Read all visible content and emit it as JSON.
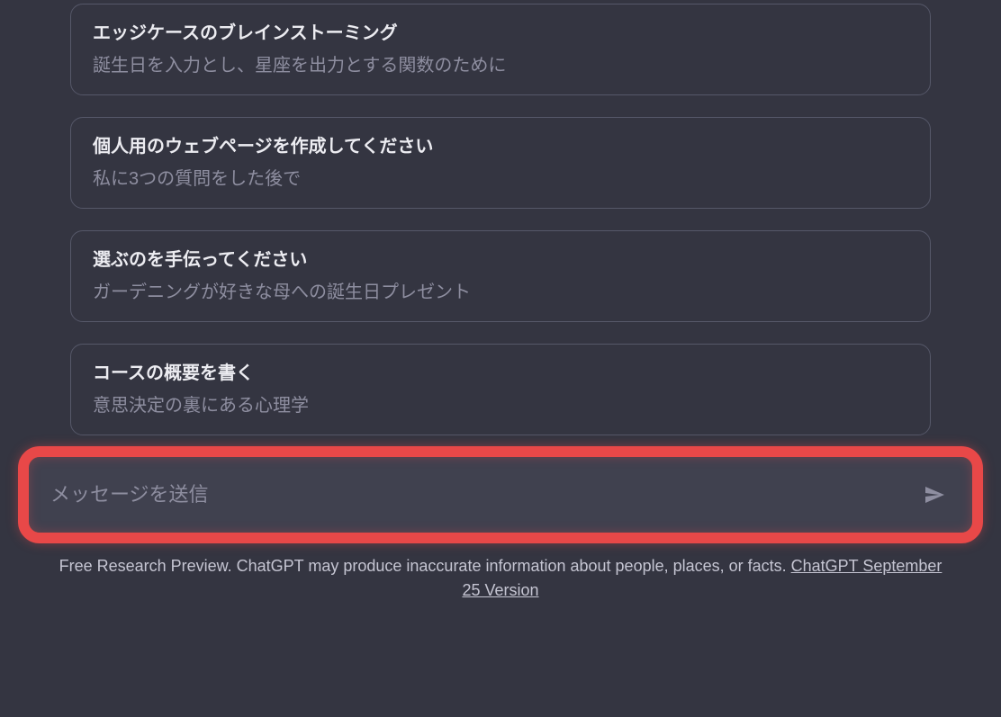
{
  "suggestions": [
    {
      "title": "エッジケースのブレインストーミング",
      "subtitle": "誕生日を入力とし、星座を出力とする関数のために"
    },
    {
      "title": "個人用のウェブページを作成してください",
      "subtitle": "私に3つの質問をした後で"
    },
    {
      "title": "選ぶのを手伝ってください",
      "subtitle": "ガーデニングが好きな母への誕生日プレゼント"
    },
    {
      "title": "コースの概要を書く",
      "subtitle": "意思決定の裏にある心理学"
    }
  ],
  "input": {
    "placeholder": "メッセージを送信"
  },
  "footer": {
    "text_before": "Free Research Preview. ChatGPT may produce inaccurate information about people, places, or facts. ",
    "link": "ChatGPT September 25 Version"
  }
}
